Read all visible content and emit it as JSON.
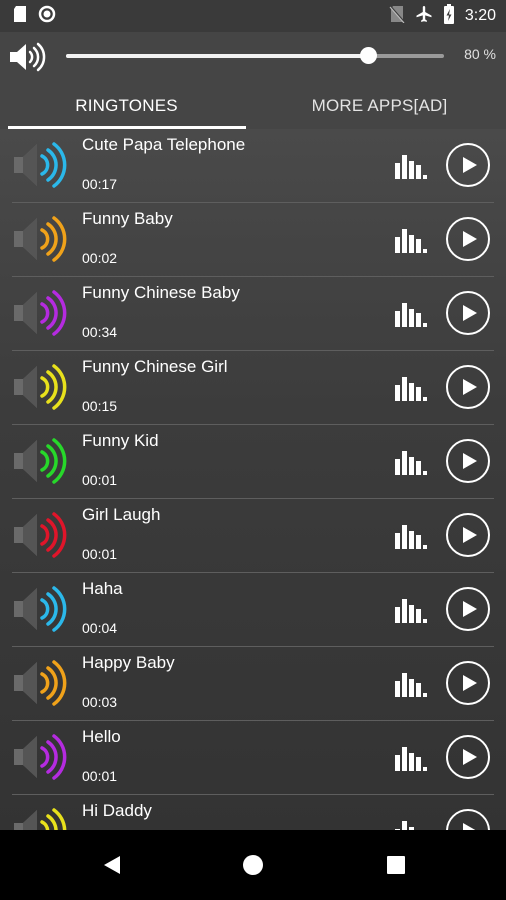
{
  "status_bar": {
    "time": "3:20",
    "left_icons": [
      "sd-card-icon",
      "circle-status-icon"
    ],
    "right_icons": [
      "no-sim-icon",
      "airplane-mode-icon",
      "battery-charging-icon"
    ]
  },
  "volume": {
    "label": "80 %",
    "level": 0.8
  },
  "tabs": [
    {
      "label": "RINGTONES",
      "selected": true
    },
    {
      "label": "MORE APPS[AD]",
      "selected": false
    }
  ],
  "colors": {
    "blue": "#2bb8ea",
    "orange": "#f0a21a",
    "purple": "#b52be0",
    "yellow": "#e8e11c",
    "green": "#27d82a",
    "red": "#e0152a"
  },
  "ringtones": [
    {
      "name": "Cute Papa Telephone",
      "duration": "00:17",
      "color": "#2bb8ea"
    },
    {
      "name": "Funny Baby",
      "duration": "00:02",
      "color": "#f0a21a"
    },
    {
      "name": "Funny Chinese Baby",
      "duration": "00:34",
      "color": "#b52be0"
    },
    {
      "name": "Funny Chinese Girl",
      "duration": "00:15",
      "color": "#e8e11c"
    },
    {
      "name": "Funny Kid",
      "duration": "00:01",
      "color": "#27d82a"
    },
    {
      "name": "Girl Laugh",
      "duration": "00:01",
      "color": "#e0152a"
    },
    {
      "name": "Haha",
      "duration": "00:04",
      "color": "#2bb8ea"
    },
    {
      "name": "Happy Baby",
      "duration": "00:03",
      "color": "#f0a21a"
    },
    {
      "name": "Hello",
      "duration": "00:01",
      "color": "#b52be0"
    },
    {
      "name": "Hi Daddy",
      "duration": "",
      "color": "#e8e11c"
    }
  ],
  "nav_bar": {
    "icons": [
      "back-icon",
      "home-icon",
      "recents-icon"
    ]
  }
}
